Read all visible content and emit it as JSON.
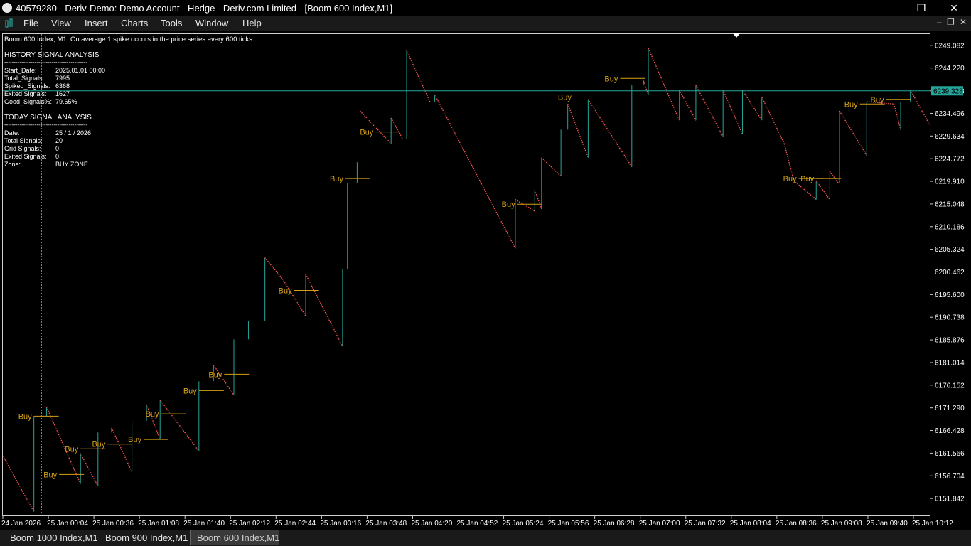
{
  "window": {
    "title": "40579280 - Deriv-Demo: Demo Account - Hedge - Deriv.com Limited - [Boom 600 Index,M1]"
  },
  "menu": {
    "items": [
      "File",
      "View",
      "Insert",
      "Charts",
      "Tools",
      "Window",
      "Help"
    ]
  },
  "chart_header": "Boom 600 Index, M1:  On average 1 spike occurs in the price series every 600 ticks",
  "panel": {
    "history_title": "HISTORY SIGNAL ANALYSIS",
    "today_title": "TODAY SIGNAL ANALYSIS",
    "divider": "--------------------------------------------",
    "history_rows": [
      {
        "label": "Start_Date:",
        "value": "2025.01.01 00:00"
      },
      {
        "label": "Total_Signals:",
        "value": "7995"
      },
      {
        "label": "Spiked_Signals:",
        "value": "6368"
      },
      {
        "label": "Exited Signals:",
        "value": "1627"
      },
      {
        "label": "Good_Signals%:",
        "value": "79.65%"
      }
    ],
    "today_rows": [
      {
        "label": "Date:",
        "value": "25 / 1 / 2026"
      },
      {
        "label": "Total Signals:",
        "value": "20"
      },
      {
        "label": "Grid Signals:",
        "value": "0"
      },
      {
        "label": "Exited Signals:",
        "value": "0"
      },
      {
        "label": "Zone:",
        "value": "BUY ZONE"
      }
    ]
  },
  "colors": {
    "background": "#000000",
    "bull": "#26a69a",
    "bear": "#ef5350",
    "signal": "#d4a017",
    "axis_text": "#ffffff",
    "price_line": "#26a69a"
  },
  "chart_data": {
    "type": "line",
    "symbol": "Boom 600 Index",
    "timeframe": "M1",
    "y_ticks": [
      "6249.082",
      "6244.220",
      "6239.328",
      "6234.496",
      "6229.634",
      "6224.772",
      "6219.910",
      "6215.048",
      "6210.186",
      "6205.324",
      "6200.462",
      "6195.600",
      "6190.738",
      "6185.876",
      "6181.014",
      "6176.152",
      "6171.290",
      "6166.428",
      "6161.566",
      "6156.704",
      "6151.842"
    ],
    "current_price": "6239.328",
    "x_ticks": [
      "24 Jan 2026",
      "25 Jan 00:04",
      "25 Jan 00:36",
      "25 Jan 01:08",
      "25 Jan 01:40",
      "25 Jan 02:12",
      "25 Jan 02:44",
      "25 Jan 03:16",
      "25 Jan 03:48",
      "25 Jan 04:20",
      "25 Jan 04:52",
      "25 Jan 05:24",
      "25 Jan 05:56",
      "25 Jan 06:28",
      "25 Jan 07:00",
      "25 Jan 07:32",
      "25 Jan 08:04",
      "25 Jan 08:36",
      "25 Jan 09:08",
      "25 Jan 09:40",
      "25 Jan 10:12"
    ],
    "ylim": [
      6148.2,
      6251.5
    ],
    "price_path": [
      {
        "bar": 0,
        "price": 6161.0
      },
      {
        "bar": 32,
        "price": 6149.0
      },
      {
        "bar": 32,
        "price": 6169.5
      },
      {
        "bar": 45,
        "price": 6171.5
      },
      {
        "bar": 80,
        "price": 6155.0
      },
      {
        "bar": 80,
        "price": 6161.5
      },
      {
        "bar": 98,
        "price": 6154.5
      },
      {
        "bar": 98,
        "price": 6166.0
      },
      {
        "bar": 112,
        "price": 6167.0
      },
      {
        "bar": 133,
        "price": 6157.5
      },
      {
        "bar": 133,
        "price": 6168.5
      },
      {
        "bar": 148,
        "price": 6172.0
      },
      {
        "bar": 162,
        "price": 6164.5
      },
      {
        "bar": 162,
        "price": 6173.0
      },
      {
        "bar": 202,
        "price": 6162.0
      },
      {
        "bar": 202,
        "price": 6177.0
      },
      {
        "bar": 217,
        "price": 6180.5
      },
      {
        "bar": 238,
        "price": 6174.0
      },
      {
        "bar": 238,
        "price": 6186.0
      },
      {
        "bar": 253,
        "price": 6190.0
      },
      {
        "bar": 270,
        "price": 6203.5
      },
      {
        "bar": 288,
        "price": 6199.0
      },
      {
        "bar": 312,
        "price": 6191.0
      },
      {
        "bar": 312,
        "price": 6200.0
      },
      {
        "bar": 350,
        "price": 6184.5
      },
      {
        "bar": 350,
        "price": 6201.0
      },
      {
        "bar": 355,
        "price": 6219.5
      },
      {
        "bar": 365,
        "price": 6224.0
      },
      {
        "bar": 368,
        "price": 6235.0
      },
      {
        "bar": 400,
        "price": 6228.0
      },
      {
        "bar": 400,
        "price": 6233.5
      },
      {
        "bar": 412,
        "price": 6229.0
      },
      {
        "bar": 416,
        "price": 6248.0
      },
      {
        "bar": 440,
        "price": 6237.0
      },
      {
        "bar": 445,
        "price": 6238.5
      },
      {
        "bar": 528,
        "price": 6205.5
      },
      {
        "bar": 528,
        "price": 6216.0
      },
      {
        "bar": 548,
        "price": 6213.5
      },
      {
        "bar": 548,
        "price": 6218.0
      },
      {
        "bar": 555,
        "price": 6214.0
      },
      {
        "bar": 555,
        "price": 6225.0
      },
      {
        "bar": 575,
        "price": 6221.0
      },
      {
        "bar": 575,
        "price": 6231.0
      },
      {
        "bar": 582,
        "price": 6236.5
      },
      {
        "bar": 603,
        "price": 6225.0
      },
      {
        "bar": 603,
        "price": 6237.5
      },
      {
        "bar": 648,
        "price": 6223.0
      },
      {
        "bar": 648,
        "price": 6240.5
      },
      {
        "bar": 660,
        "price": 6241.5
      },
      {
        "bar": 665,
        "price": 6238.5
      },
      {
        "bar": 665,
        "price": 6248.5
      },
      {
        "bar": 697,
        "price": 6233.0
      },
      {
        "bar": 697,
        "price": 6239.5
      },
      {
        "bar": 714,
        "price": 6233.0
      },
      {
        "bar": 714,
        "price": 6240.5
      },
      {
        "bar": 742,
        "price": 6229.5
      },
      {
        "bar": 742,
        "price": 6239.5
      },
      {
        "bar": 762,
        "price": 6230.0
      },
      {
        "bar": 762,
        "price": 6239.5
      },
      {
        "bar": 782,
        "price": 6233.0
      },
      {
        "bar": 782,
        "price": 6238.0
      },
      {
        "bar": 805,
        "price": 6228.0
      },
      {
        "bar": 815,
        "price": 6220.0
      },
      {
        "bar": 838,
        "price": 6216.0
      },
      {
        "bar": 838,
        "price": 6220.0
      },
      {
        "bar": 852,
        "price": 6216.0
      },
      {
        "bar": 852,
        "price": 6222.0
      },
      {
        "bar": 861,
        "price": 6219.5
      },
      {
        "bar": 862,
        "price": 6235.0
      },
      {
        "bar": 890,
        "price": 6225.5
      },
      {
        "bar": 890,
        "price": 6237.0
      },
      {
        "bar": 918,
        "price": 6236.5
      },
      {
        "bar": 925,
        "price": 6231.0
      },
      {
        "bar": 925,
        "price": 6237.0
      },
      {
        "bar": 935,
        "price": 6239.5
      },
      {
        "bar": 955,
        "price": 6232.0
      }
    ],
    "bars_total": 955,
    "signals": [
      {
        "label": "Buy",
        "bar": 32,
        "price": 6169.5
      },
      {
        "label": "Buy",
        "bar": 58,
        "price": 6157.0
      },
      {
        "label": "Buy",
        "bar": 80,
        "price": 6162.5
      },
      {
        "label": "Buy",
        "bar": 108,
        "price": 6163.5
      },
      {
        "label": "Buy",
        "bar": 145,
        "price": 6164.5
      },
      {
        "label": "Buy",
        "bar": 163,
        "price": 6170.0
      },
      {
        "label": "Buy",
        "bar": 202,
        "price": 6175.0
      },
      {
        "label": "Buy",
        "bar": 228,
        "price": 6178.5
      },
      {
        "label": "Buy",
        "bar": 300,
        "price": 6196.5
      },
      {
        "label": "Buy",
        "bar": 353,
        "price": 6220.5
      },
      {
        "label": "Buy",
        "bar": 384,
        "price": 6230.5
      },
      {
        "label": "Buy",
        "bar": 530,
        "price": 6215.0
      },
      {
        "label": "Buy",
        "bar": 588,
        "price": 6238.0
      },
      {
        "label": "Buy",
        "bar": 636,
        "price": 6242.0
      },
      {
        "label": "Buy",
        "bar": 820,
        "price": 6220.5
      },
      {
        "label": "Buy",
        "bar": 838,
        "price": 6220.5
      },
      {
        "label": "Buy",
        "bar": 883,
        "price": 6236.5
      },
      {
        "label": "Buy",
        "bar": 910,
        "price": 6237.5
      }
    ]
  },
  "tabs": [
    {
      "label": "Boom 1000 Index,M1",
      "active": false
    },
    {
      "label": "Boom 900 Index,M1",
      "active": false
    },
    {
      "label": "Boom 600 Index,M1",
      "active": true
    }
  ]
}
